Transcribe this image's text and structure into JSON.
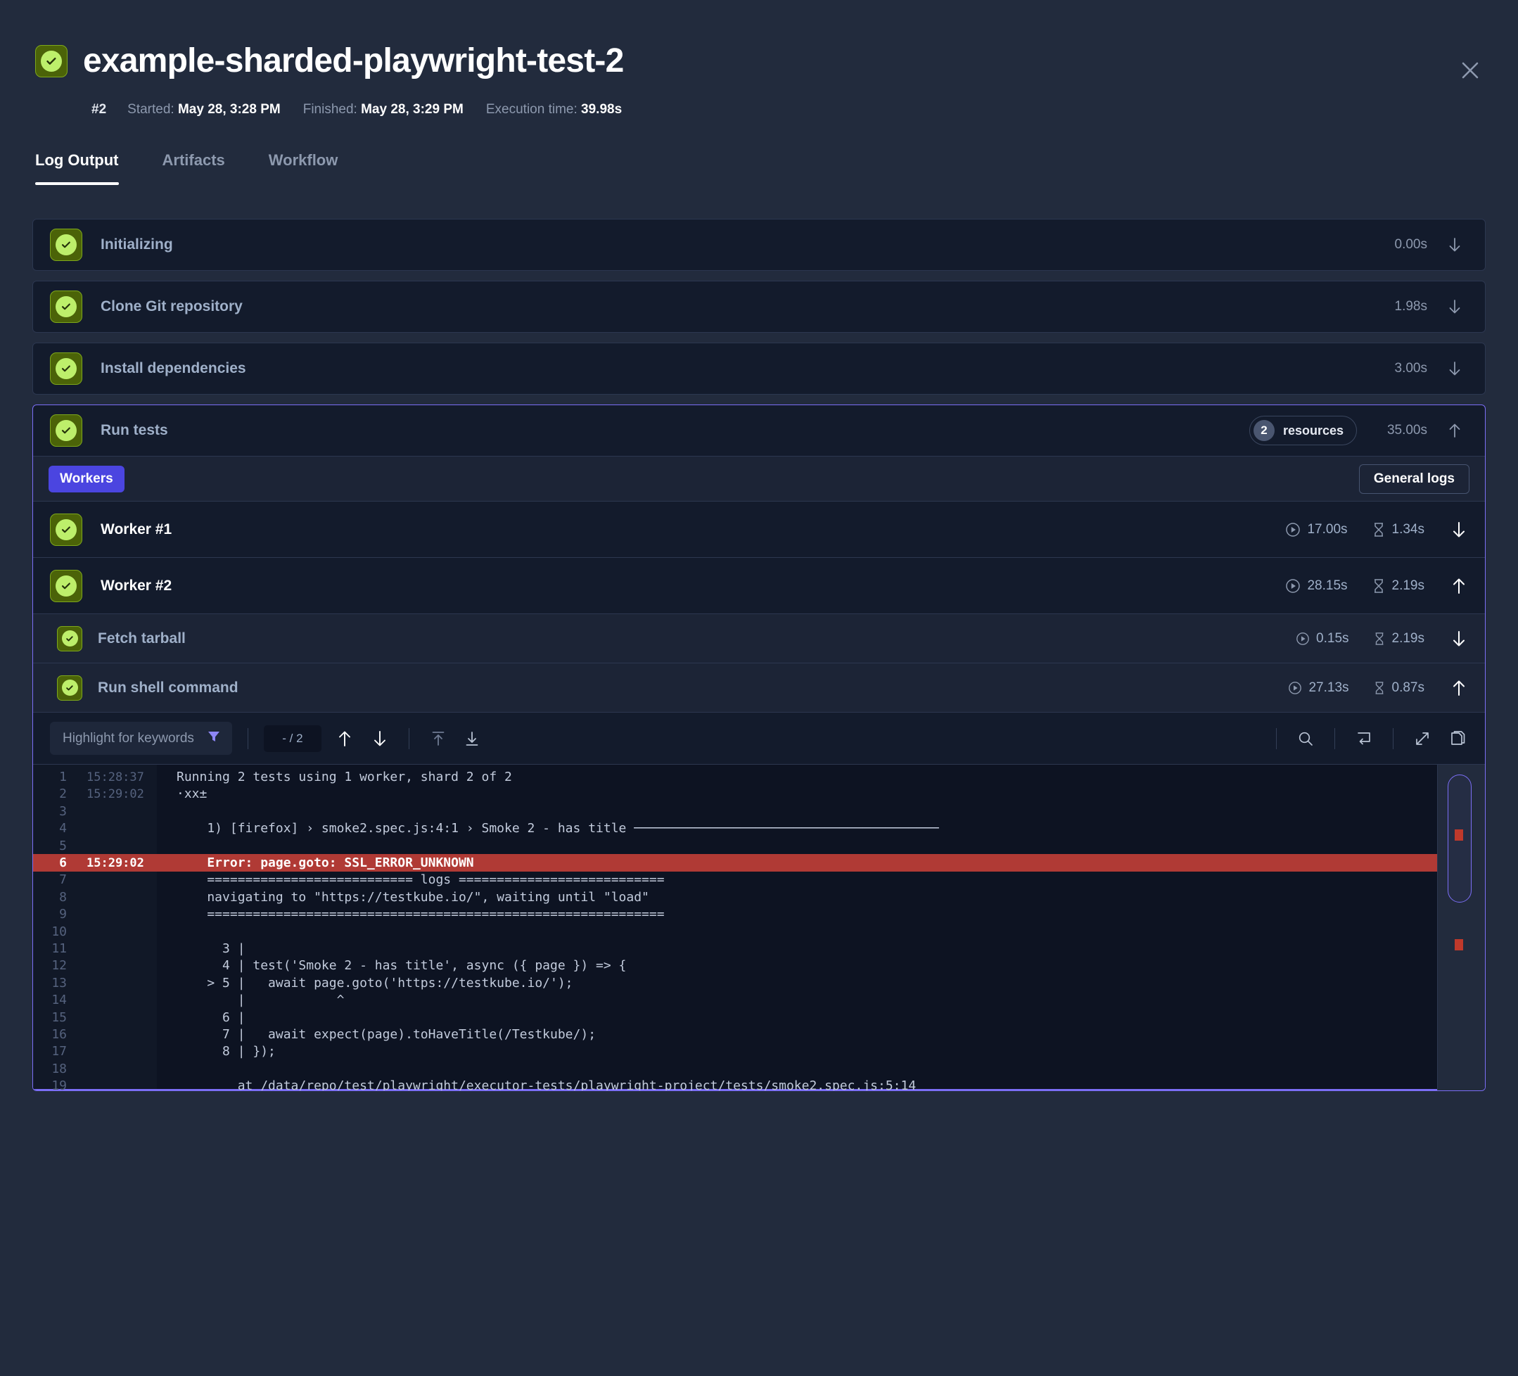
{
  "header": {
    "title": "example-sharded-playwright-test-2",
    "status_icon": "check-circle-icon",
    "close_icon": "close-icon",
    "run_id": "#2",
    "started_label": "Started:",
    "started_value": "May 28, 3:28 PM",
    "finished_label": "Finished:",
    "finished_value": "May 28, 3:29 PM",
    "exec_label": "Execution time:",
    "exec_value": "39.98s"
  },
  "tabs": [
    {
      "label": "Log Output",
      "active": true
    },
    {
      "label": "Artifacts",
      "active": false
    },
    {
      "label": "Workflow",
      "active": false
    }
  ],
  "steps": [
    {
      "name": "Initializing",
      "duration": "0.00s",
      "chevron": "chevron-down-icon"
    },
    {
      "name": "Clone Git repository",
      "duration": "1.98s",
      "chevron": "chevron-down-icon"
    },
    {
      "name": "Install dependencies",
      "duration": "3.00s",
      "chevron": "chevron-down-icon"
    }
  ],
  "run_tests": {
    "name": "Run tests",
    "resources_count": "2",
    "resources_label": "resources",
    "duration": "35.00s",
    "chevron": "chevron-up-icon",
    "workers_pill": "Workers",
    "general_logs_button": "General logs",
    "workers": [
      {
        "name": "Worker #1",
        "run_time": "17.00s",
        "queue_time": "1.34s",
        "chevron": "chevron-down-icon",
        "sub": false
      },
      {
        "name": "Worker #2",
        "run_time": "28.15s",
        "queue_time": "2.19s",
        "chevron": "chevron-up-icon",
        "sub": false
      },
      {
        "name": "Fetch tarball",
        "run_time": "0.15s",
        "queue_time": "2.19s",
        "chevron": "chevron-down-icon",
        "sub": true
      },
      {
        "name": "Run shell command",
        "run_time": "27.13s",
        "queue_time": "0.87s",
        "chevron": "chevron-up-icon",
        "sub": true
      }
    ]
  },
  "log_toolbar": {
    "keyword_placeholder": "Highlight for keywords",
    "filter_icon": "filter-icon",
    "pager_value": "- / 2",
    "prev_icon": "arrow-up-icon",
    "next_icon": "arrow-down-icon",
    "scroll_top_icon": "scroll-to-top-icon",
    "scroll_bottom_icon": "scroll-to-bottom-icon",
    "search_icon": "search-icon",
    "wrap_icon": "wrap-lines-icon",
    "expand_icon": "expand-fullscreen-icon",
    "copy_icon": "copy-icon"
  },
  "log": {
    "lines": [
      {
        "n": "1",
        "ts": "15:28:37",
        "text": "Running 2 tests using 1 worker, shard 2 of 2",
        "error": false
      },
      {
        "n": "2",
        "ts": "15:29:02",
        "text": "·xx±",
        "error": false
      },
      {
        "n": "3",
        "ts": "",
        "text": "",
        "error": false
      },
      {
        "n": "4",
        "ts": "",
        "text": "    1) [firefox] › smoke2.spec.js:4:1 › Smoke 2 - has title ────────────────────────────────────────",
        "error": false
      },
      {
        "n": "5",
        "ts": "",
        "text": "",
        "error": false
      },
      {
        "n": "6",
        "ts": "15:29:02",
        "text": "    Error: page.goto: SSL_ERROR_UNKNOWN",
        "error": true
      },
      {
        "n": "7",
        "ts": "",
        "text": "    =========================== logs ===========================",
        "error": false
      },
      {
        "n": "8",
        "ts": "",
        "text": "    navigating to \"https://testkube.io/\", waiting until \"load\"",
        "error": false
      },
      {
        "n": "9",
        "ts": "",
        "text": "    ============================================================",
        "error": false
      },
      {
        "n": "10",
        "ts": "",
        "text": "",
        "error": false
      },
      {
        "n": "11",
        "ts": "",
        "text": "      3 |",
        "error": false
      },
      {
        "n": "12",
        "ts": "",
        "text": "      4 | test('Smoke 2 - has title', async ({ page }) => {",
        "error": false
      },
      {
        "n": "13",
        "ts": "",
        "text": "    > 5 |   await page.goto('https://testkube.io/');",
        "error": false
      },
      {
        "n": "14",
        "ts": "",
        "text": "        |            ^",
        "error": false
      },
      {
        "n": "15",
        "ts": "",
        "text": "      6 |",
        "error": false
      },
      {
        "n": "16",
        "ts": "",
        "text": "      7 |   await expect(page).toHaveTitle(/Testkube/);",
        "error": false
      },
      {
        "n": "17",
        "ts": "",
        "text": "      8 | });",
        "error": false
      },
      {
        "n": "18",
        "ts": "",
        "text": "",
        "error": false
      },
      {
        "n": "19",
        "ts": "",
        "text": "        at /data/repo/test/playwright/executor-tests/playwright-project/tests/smoke2.spec.js:5:14",
        "error": false
      }
    ]
  },
  "colors": {
    "page_bg": "#222b3d",
    "card_bg": "#131b2c",
    "accent": "#7b6ef6",
    "workers_pill": "#4b45e0",
    "status_green": "#bdef6b",
    "error_red": "#b03a35",
    "muted_text": "#8d99ae"
  }
}
